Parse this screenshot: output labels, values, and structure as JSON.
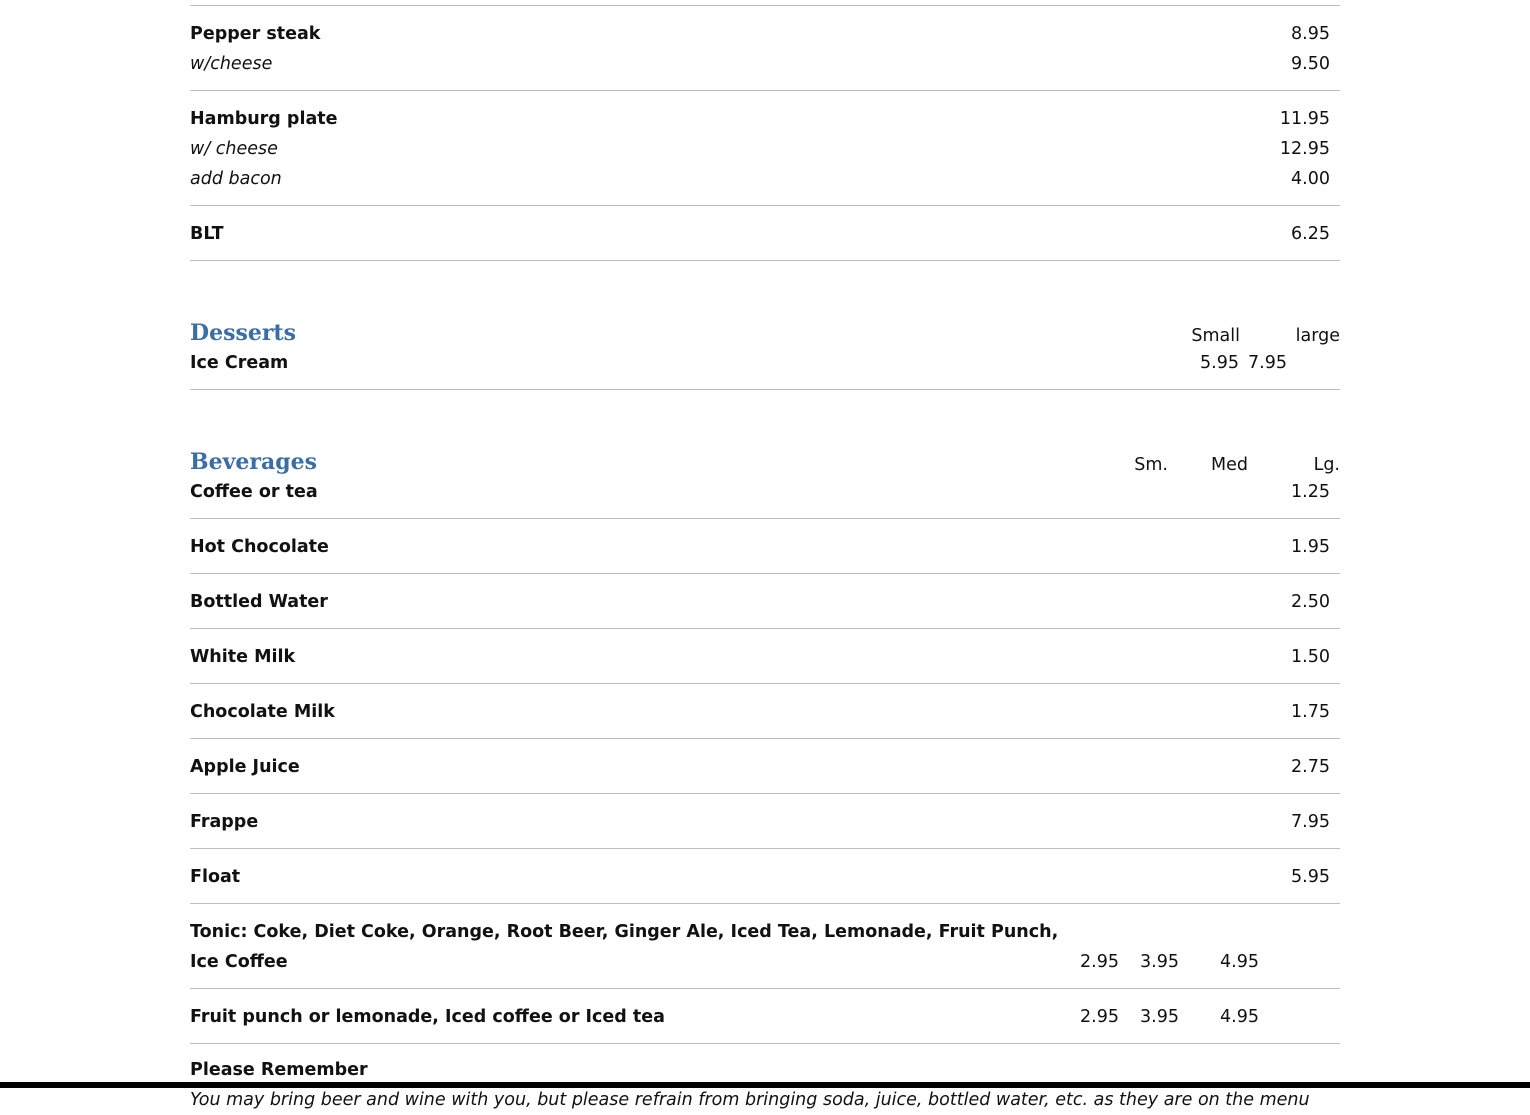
{
  "mains": [
    {
      "lines": [
        {
          "name": "Pepper steak",
          "price": "8.95",
          "kind": "main"
        },
        {
          "name": "w/cheese",
          "price": "9.50",
          "kind": "sub"
        }
      ]
    },
    {
      "lines": [
        {
          "name": "Hamburg plate",
          "price": "11.95",
          "kind": "main"
        },
        {
          "name": "w/ cheese",
          "price": "12.95",
          "kind": "sub"
        },
        {
          "name": "add bacon",
          "price": "4.00",
          "kind": "sub"
        }
      ]
    },
    {
      "lines": [
        {
          "name": "BLT",
          "price": "6.25",
          "kind": "main"
        }
      ]
    }
  ],
  "desserts": {
    "title": "Desserts",
    "col_small": "Small",
    "col_large": "large",
    "items": [
      {
        "name": "Ice Cream",
        "small": "5.95",
        "large": "7.95"
      }
    ]
  },
  "beverages": {
    "title": "Beverages",
    "col_sm": "Sm.",
    "col_med": "Med",
    "col_lg": "Lg.",
    "items": [
      {
        "name": "Coffee or tea",
        "price": "1.25"
      },
      {
        "name": "Hot Chocolate",
        "price": "1.95"
      },
      {
        "name": "Bottled Water",
        "price": "2.50"
      },
      {
        "name": "White Milk",
        "price": "1.50"
      },
      {
        "name": "Chocolate Milk",
        "price": "1.75"
      },
      {
        "name": "Apple Juice",
        "price": "2.75"
      },
      {
        "name": "Frappe",
        "price": "7.95"
      },
      {
        "name": "Float",
        "price": "5.95"
      }
    ],
    "sized_items": [
      {
        "name": "Tonic: Coke, Diet Coke, Orange, Root Beer, Ginger Ale, Iced Tea, Lemonade, Fruit Punch, Ice Coffee",
        "sm": "2.95",
        "med": "3.95",
        "lg": "4.95"
      },
      {
        "name": "Fruit punch or lemonade, Iced coffee or Iced tea",
        "sm": "2.95",
        "med": "3.95",
        "lg": "4.95"
      }
    ]
  },
  "notice": {
    "title": "Please Remember",
    "body": "You may bring beer and wine with you, but please refrain from bringing soda, juice, bottled water, etc. as they are on the menu"
  }
}
